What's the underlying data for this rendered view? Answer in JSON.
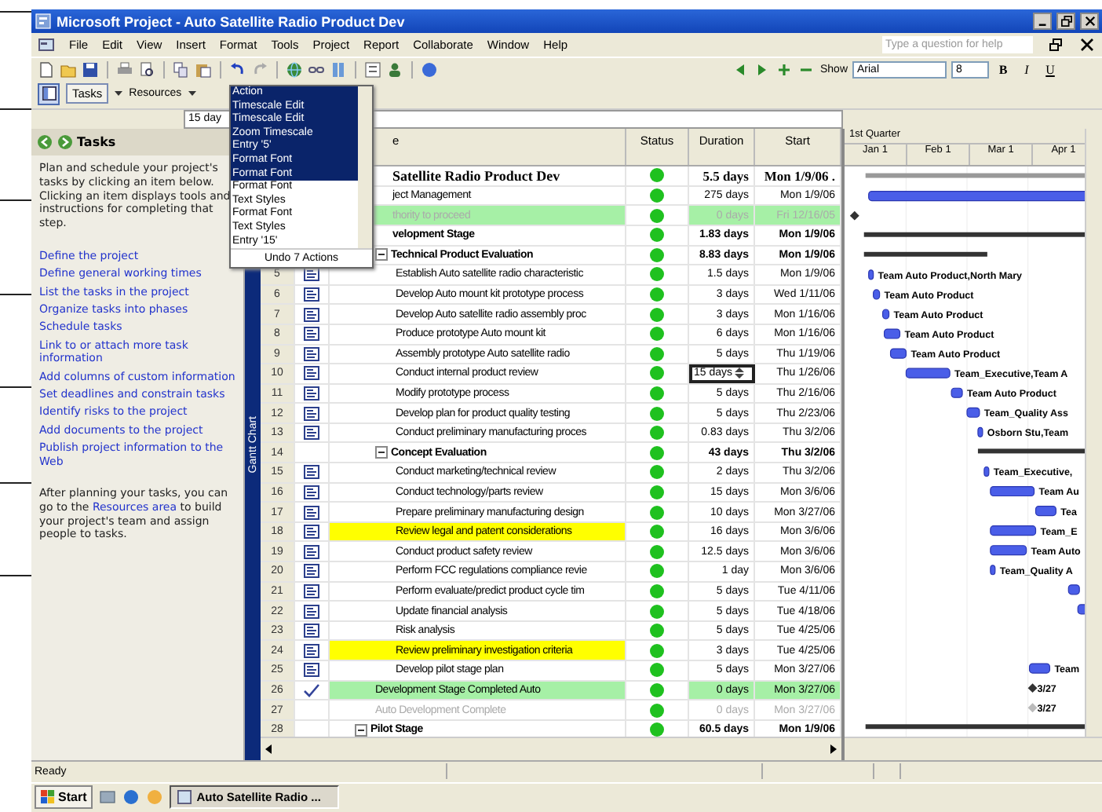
{
  "window": {
    "title": "Microsoft Project - Auto  Satellite Radio Product Dev"
  },
  "menu": [
    "File",
    "Edit",
    "View",
    "Insert",
    "Format",
    "Tools",
    "Project",
    "Report",
    "Collaborate",
    "Window",
    "Help"
  ],
  "help_box": {
    "placeholder": "Type a question for help"
  },
  "formatting": {
    "show": "Show",
    "font": "Arial",
    "size": "8",
    "bold": "B",
    "italic": "I",
    "underline": "U"
  },
  "view_bar": {
    "tasks": "Tasks",
    "resources": "Resources",
    "entry": "15 day"
  },
  "undo_list": {
    "items": [
      {
        "label": "Action",
        "selected": true
      },
      {
        "label": "Timescale Edit",
        "selected": true
      },
      {
        "label": "Timescale Edit",
        "selected": true
      },
      {
        "label": "Zoom Timescale",
        "selected": true
      },
      {
        "label": "Entry '5'",
        "selected": true
      },
      {
        "label": "Format Font",
        "selected": true
      },
      {
        "label": "Format Font",
        "selected": true
      },
      {
        "label": "Format Font",
        "selected": false
      },
      {
        "label": "Text Styles",
        "selected": false
      },
      {
        "label": "Format Font",
        "selected": false
      },
      {
        "label": "Text Styles",
        "selected": false
      },
      {
        "label": "Entry '15'",
        "selected": false
      }
    ],
    "footer": "Undo 7 Actions"
  },
  "task_pane": {
    "title": "Tasks",
    "intro": "Plan and schedule your project's tasks by clicking an item below. Clicking an item displays tools and instructions for completing that step.",
    "links": [
      "Define the project",
      "Define general working times",
      "List the tasks in the project",
      "Organize tasks into phases",
      "Schedule tasks",
      "Link to or attach more task information",
      "Add columns of custom information",
      "Set deadlines and constrain tasks",
      "Identify risks to the project",
      "Add documents to the project",
      "Publish project information to the Web"
    ],
    "outro": {
      "before": "After planning your tasks, you can go to the",
      "link": "Resources area",
      "after": "to build your project's team and assign people to tasks."
    }
  },
  "view_label": "Gantt Chart",
  "table": {
    "columns": [
      "e",
      "Status",
      "Duration",
      "Start"
    ],
    "rows": [
      {
        "name": "Satellite Radio Product Dev",
        "duration": "5.5 days",
        "start": "Mon 1/9/06 .",
        "color": "#1fc11f",
        "kind": "project",
        "clipped": true,
        "selected": false,
        "children": [
          {
            "name": "ject Management",
            "duration": "275 days",
            "start": "Mon 1/9/06",
            "color": "#1fc11f",
            "kind": "task",
            "clipped": true,
            "selected": false
          },
          {
            "name": "thority to proceed",
            "duration": "0 days",
            "start": "Fri 12/16/05",
            "color": "#1fc11f",
            "kind": "milestone",
            "highlighted": true,
            "inactive": true,
            "clipped": true,
            "selected": false
          },
          {
            "name": "velopment Stage",
            "duration": "1.83 days",
            "start": "Mon 1/9/06",
            "color": "#1fc11f",
            "kind": "summary",
            "clipped": true,
            "selected": false,
            "children": [
              {
                "name": "Technical Product Evaluation",
                "duration": "8.83 days",
                "start": "Mon 1/9/06",
                "color": "#1fc11f",
                "kind": "summary",
                "selected": false,
                "children": [
                  {
                    "id": "5",
                    "name": "Establish Auto satellite radio characteristic",
                    "duration": "1.5 days",
                    "start": "Mon 1/9/06",
                    "color": "#1fc11f",
                    "kind": "task",
                    "notes": true,
                    "resources": "Team Auto Product,North Mary",
                    "selected": false
                  },
                  {
                    "id": "6",
                    "name": "Develop Auto mount kit prototype process",
                    "duration": "3 days",
                    "start": "Wed 1/11/06",
                    "color": "#1fc11f",
                    "kind": "task",
                    "notes": true,
                    "resources": "Team Auto Product",
                    "selected": false
                  },
                  {
                    "id": "7",
                    "name": "Develop Auto satellite radio assembly proc",
                    "duration": "3 days",
                    "start": "Mon 1/16/06",
                    "color": "#1fc11f",
                    "kind": "task",
                    "notes": true,
                    "resources": "Team Auto Product",
                    "selected": false
                  },
                  {
                    "id": "8",
                    "name": "Produce prototype Auto mount kit",
                    "duration": "6 days",
                    "start": "Mon 1/16/06",
                    "color": "#1fc11f",
                    "kind": "task",
                    "notes": true,
                    "resources": "Team Auto Product",
                    "selected": false
                  },
                  {
                    "id": "9",
                    "name": "Assembly prototype Auto satellite radio",
                    "duration": "5 days",
                    "start": "Thu 1/19/06",
                    "color": "#1fc11f",
                    "kind": "task",
                    "notes": true,
                    "resources": "Team Auto Product",
                    "selected": false
                  },
                  {
                    "id": "10",
                    "name": "Conduct internal product review",
                    "duration": "15 days",
                    "start": "Thu 1/26/06",
                    "color": "#1fc11f",
                    "kind": "task",
                    "notes": true,
                    "resources": "Team_Executive,Team A",
                    "selected": true
                  },
                  {
                    "id": "11",
                    "name": "Modify prototype process",
                    "duration": "5 days",
                    "start": "Thu 2/16/06",
                    "color": "#1fc11f",
                    "kind": "task",
                    "notes": true,
                    "resources": "Team Auto Product",
                    "selected": false
                  },
                  {
                    "id": "12",
                    "name": "Develop plan for product quality testing",
                    "duration": "5 days",
                    "start": "Thu 2/23/06",
                    "color": "#1fc11f",
                    "kind": "task",
                    "notes": true,
                    "resources": "Team_Quality Ass",
                    "selected": false
                  },
                  {
                    "id": "13",
                    "name": "Conduct preliminary manufacturing proces",
                    "duration": "0.83 days",
                    "start": "Thu 3/2/06",
                    "color": "#1fc11f",
                    "kind": "task",
                    "notes": true,
                    "resources": "Osborn Stu,Team",
                    "selected": false
                  }
                ]
              },
              {
                "id": "14",
                "name": "Concept Evaluation",
                "duration": "43 days",
                "start": "Thu 3/2/06",
                "color": "#1fc11f",
                "kind": "summary",
                "selected": false,
                "children": [
                  {
                    "id": "15",
                    "name": "Conduct marketing/technical review",
                    "duration": "2 days",
                    "start": "Thu 3/2/06",
                    "color": "#1fc11f",
                    "kind": "task",
                    "notes": true,
                    "resources": "Team_Executive,",
                    "selected": false
                  },
                  {
                    "id": "16",
                    "name": "Conduct technology/parts review",
                    "duration": "15 days",
                    "start": "Mon 3/6/06",
                    "color": "#1fc11f",
                    "kind": "task",
                    "notes": true,
                    "resources": "Team Au",
                    "selected": false
                  },
                  {
                    "id": "17",
                    "name": "Prepare preliminary manufacturing design",
                    "duration": "10 days",
                    "start": "Mon 3/27/06",
                    "color": "#1fc11f",
                    "kind": "task",
                    "notes": true,
                    "resources": "Tea",
                    "selected": false
                  },
                  {
                    "id": "18",
                    "name": "Review legal and patent considerations",
                    "duration": "16 days",
                    "start": "Mon 3/6/06",
                    "color": "#1fc11f",
                    "kind": "task",
                    "notes": true,
                    "highlighted": true,
                    "resources": "Team_E",
                    "selected": false
                  },
                  {
                    "id": "19",
                    "name": "Conduct product safety review",
                    "duration": "12.5 days",
                    "start": "Mon 3/6/06",
                    "color": "#1fc11f",
                    "kind": "task",
                    "notes": true,
                    "resources": "Team Auto",
                    "selected": false
                  },
                  {
                    "id": "20",
                    "name": "Perform FCC regulations compliance revie",
                    "duration": "1 day",
                    "start": "Mon 3/6/06",
                    "color": "#1fc11f",
                    "kind": "task",
                    "notes": true,
                    "resources": "Team_Quality A",
                    "selected": false
                  },
                  {
                    "id": "21",
                    "name": "Perform evaluate/predict product cycle tim",
                    "duration": "5 days",
                    "start": "Tue 4/11/06",
                    "color": "#1fc11f",
                    "kind": "task",
                    "notes": true,
                    "selected": false
                  },
                  {
                    "id": "22",
                    "name": "Update financial analysis",
                    "duration": "5 days",
                    "start": "Tue 4/18/06",
                    "color": "#1fc11f",
                    "kind": "task",
                    "notes": true,
                    "selected": false
                  },
                  {
                    "id": "23",
                    "name": "Risk analysis",
                    "duration": "5 days",
                    "start": "Tue 4/25/06",
                    "color": "#1fc11f",
                    "kind": "task",
                    "notes": true,
                    "selected": false
                  },
                  {
                    "id": "24",
                    "name": "Review preliminary investigation criteria",
                    "duration": "3 days",
                    "start": "Tue 4/25/06",
                    "color": "#1fc11f",
                    "kind": "task",
                    "notes": true,
                    "highlighted": true,
                    "selected": false
                  },
                  {
                    "id": "25",
                    "name": "Develop pilot stage plan",
                    "duration": "5 days",
                    "start": "Mon 3/27/06",
                    "color": "#1fc11f",
                    "kind": "task",
                    "notes": true,
                    "resources": "Team",
                    "selected": false
                  }
                ]
              },
              {
                "id": "26",
                "name": "Development Stage Completed Auto",
                "duration": "0 days",
                "start": "Mon 3/27/06",
                "color": "#1fc11f",
                "kind": "milestone",
                "done": true,
                "highlighted": true,
                "resources": "3/27",
                "selected": false
              },
              {
                "id": "27",
                "name": "Auto Development Complete",
                "duration": "0 days",
                "start": "Mon 3/27/06",
                "color": "#1fc11f",
                "kind": "milestone",
                "inactive": true,
                "resources": "3/27",
                "selected": false
              }
            ]
          },
          {
            "id": "28",
            "name": "Pilot Stage",
            "duration": "60.5 days",
            "start": "Mon 1/9/06",
            "color": "#1fc11f",
            "kind": "summary",
            "selected": false
          }
        ]
      }
    ]
  },
  "timescale": {
    "tier1": "1st Quarter",
    "tier2": [
      "Jan 1",
      "Feb 1",
      "Mar 1",
      "Apr 1"
    ]
  },
  "status_bar": "Ready",
  "taskbar": {
    "start": "Start",
    "windows": [
      {
        "label": "Auto  Satellite Radio ...",
        "selected": true
      }
    ]
  }
}
